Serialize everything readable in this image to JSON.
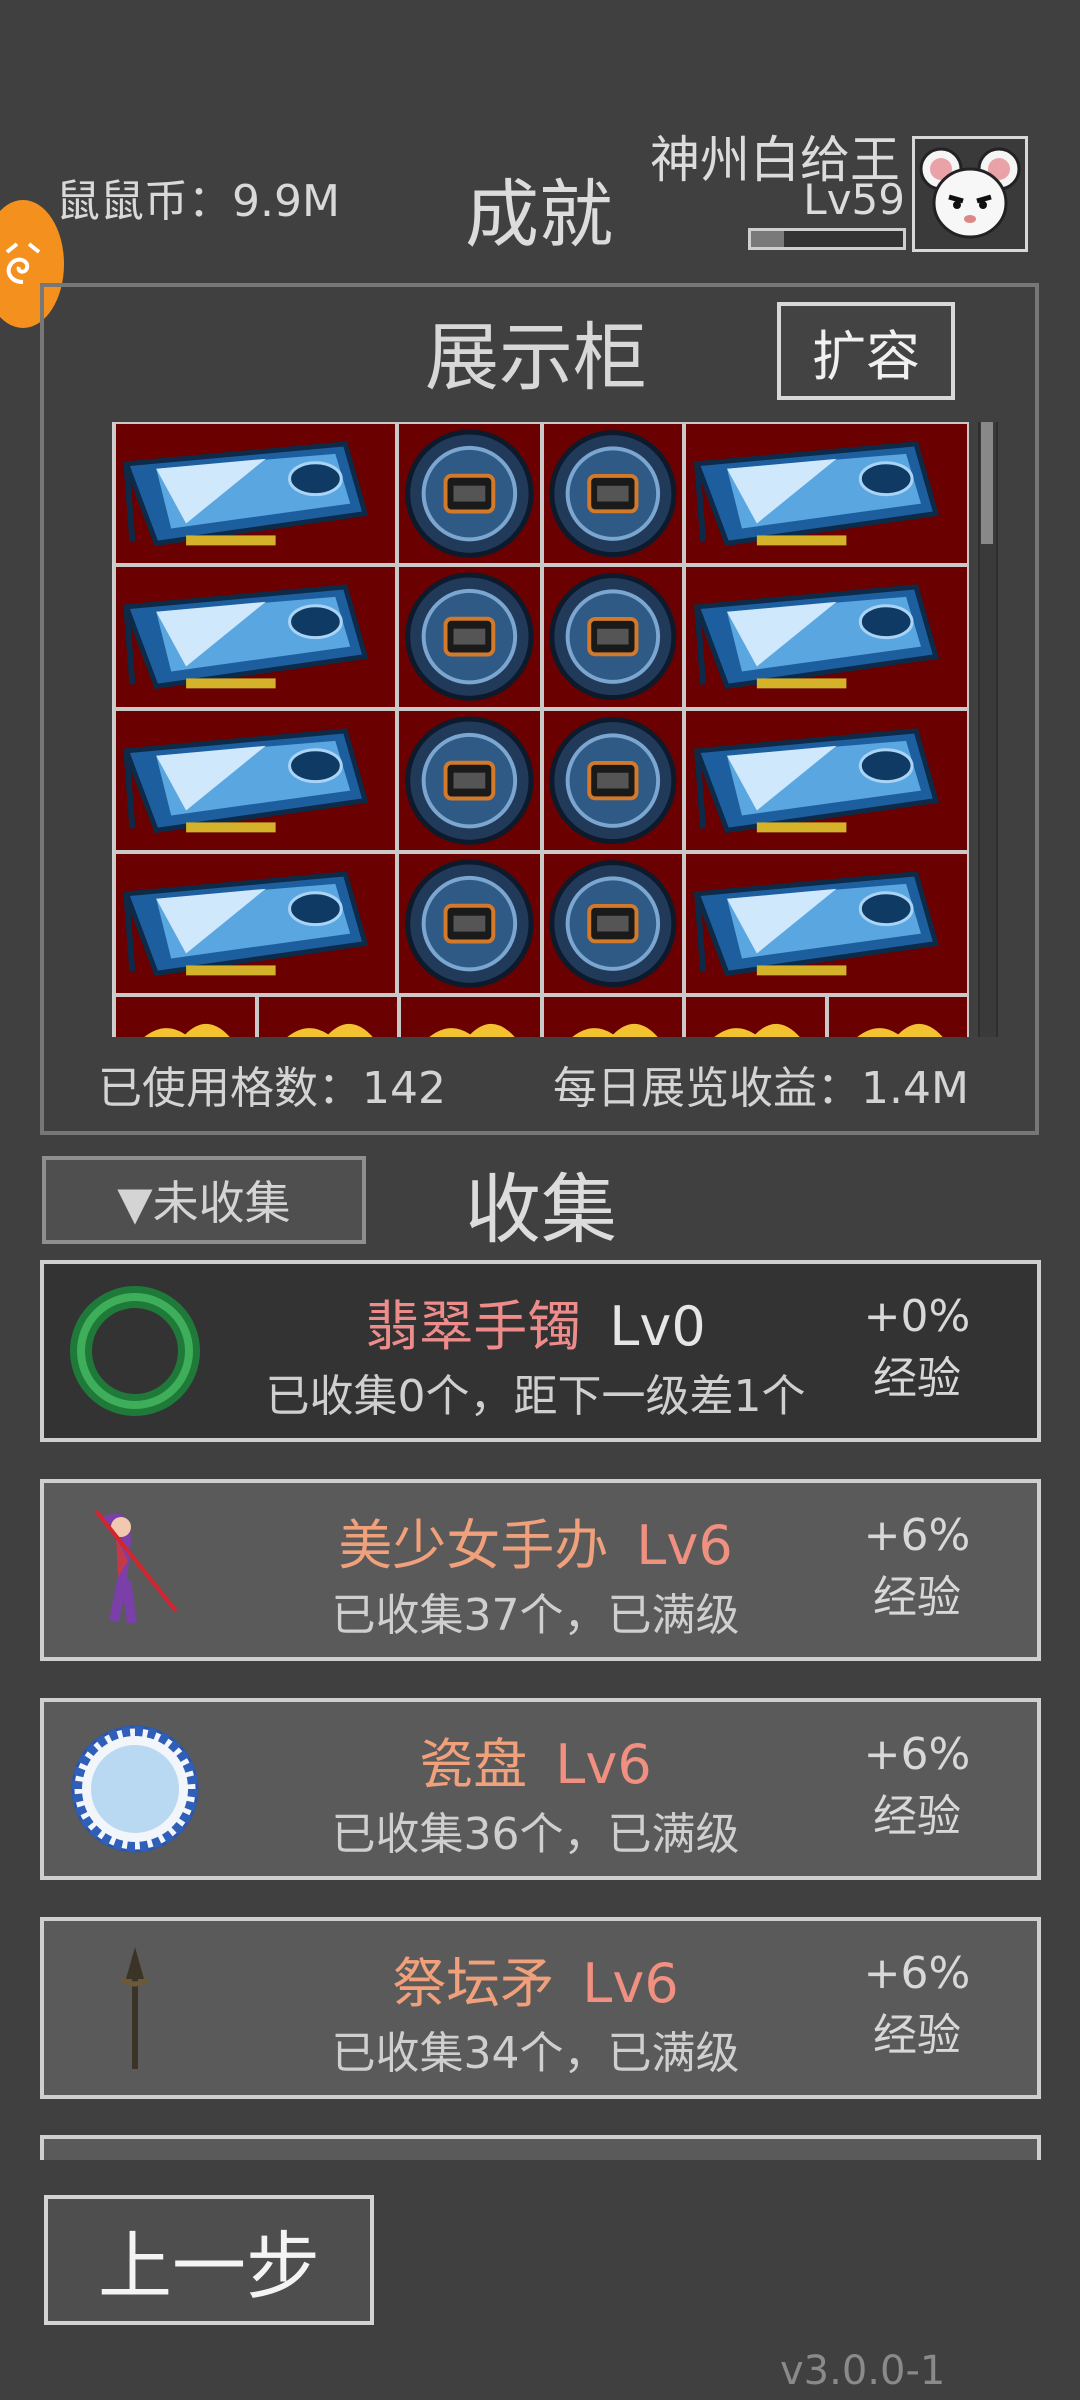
{
  "header": {
    "coins_text": "鼠鼠币：9.9M",
    "title": "成就",
    "player_name": "神州白给王",
    "level": "Lv59",
    "xp_progress": 0.22
  },
  "cabinet": {
    "title": "展示柜",
    "expand_label": "扩容",
    "used_cells_label": "已使用格数：142",
    "daily_income_label": "每日展览收益：1.4M",
    "grid_rows": [
      [
        "gpu",
        "watch",
        "watch",
        "gpu"
      ],
      [
        "gpu",
        "watch",
        "watch",
        "gpu"
      ],
      [
        "gpu",
        "watch",
        "watch",
        "gpu"
      ],
      [
        "gpu",
        "watch",
        "watch",
        "gpu"
      ]
    ]
  },
  "collection": {
    "filter_label": "▼未收集",
    "title": "收集",
    "items": [
      {
        "icon": "jade-bracelet-icon",
        "name": "翡翠手镯",
        "level": "Lv0",
        "status": "已收集0个，距下一级差1个",
        "bonus": "+0%",
        "bonus_label": "经验"
      },
      {
        "icon": "figurine-icon",
        "name": "美少女手办",
        "level": "Lv6",
        "status": "已收集37个，已满级",
        "bonus": "+6%",
        "bonus_label": "经验"
      },
      {
        "icon": "porcelain-plate-icon",
        "name": "瓷盘",
        "level": "Lv6",
        "status": "已收集36个，已满级",
        "bonus": "+6%",
        "bonus_label": "经验"
      },
      {
        "icon": "altar-spear-icon",
        "name": "祭坛矛",
        "level": "Lv6",
        "status": "已收集34个，已满级",
        "bonus": "+6%",
        "bonus_label": "经验"
      }
    ]
  },
  "footer": {
    "back_label": "上一步",
    "version": "v3.0.0-1"
  },
  "colors": {
    "background": "#404040",
    "cabinet_bg": "#6a0000",
    "accent_orange": "#f3901e"
  }
}
